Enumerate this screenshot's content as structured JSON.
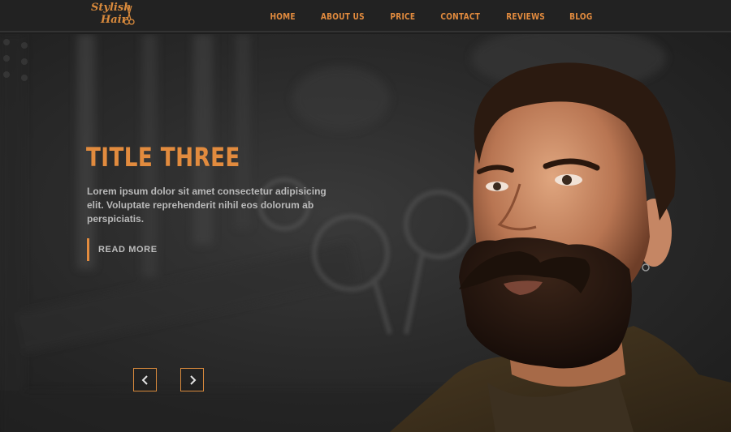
{
  "brand": {
    "logo_line1": "Stylish",
    "logo_line2": "Hair",
    "accent": "#e28b3e"
  },
  "nav": {
    "items": [
      "HOME",
      "ABOUT US",
      "PRICE",
      "CONTACT",
      "REVIEWS",
      "BLOG"
    ]
  },
  "hero": {
    "title": "TITLE THREE",
    "text": "Lorem ipsum dolor sit amet consectetur adipisicing elit. Voluptate reprehenderit nihil eos dolorum ab perspiciatis.",
    "read_more": "READ MORE",
    "prev_icon": "chevron-left-icon",
    "next_icon": "chevron-right-icon"
  }
}
